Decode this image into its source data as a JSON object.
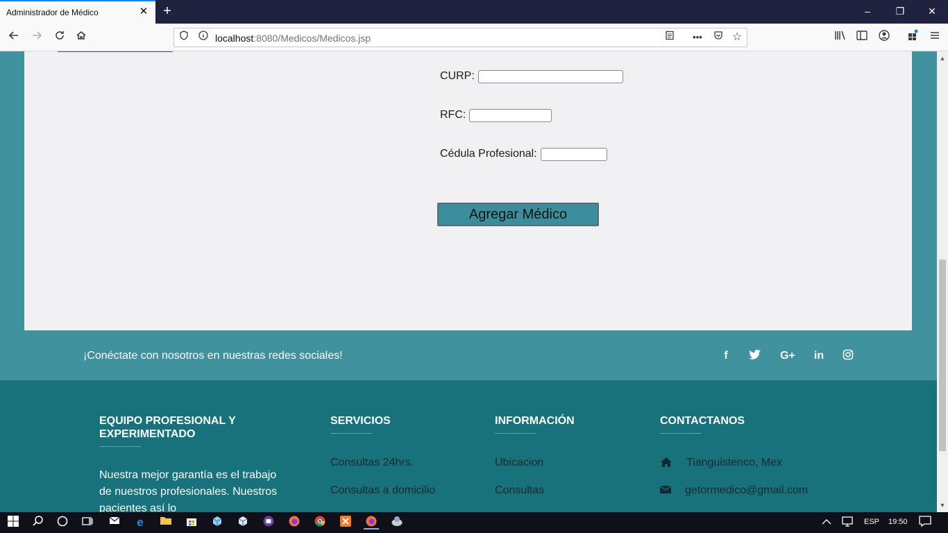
{
  "browser": {
    "tab_title": "Administrador de Médico",
    "tab_close": "✕",
    "new_tab": "+",
    "url_host": "localhost",
    "url_rest": ":8080/Medicos/Medicos.jsp",
    "window_controls": {
      "minimize": "–",
      "restore": "❐",
      "close": "✕"
    },
    "icons": [
      "back-icon",
      "forward-icon",
      "reload-icon",
      "home-icon",
      "shield-icon",
      "info-icon",
      "reader-view-icon",
      "more-icon",
      "pocket-icon",
      "bookmark-star-icon",
      "library-icon",
      "sidebar-icon",
      "account-icon",
      "extensions-icon",
      "menu-icon"
    ]
  },
  "form": {
    "curp_label": "CURP:",
    "curp_value": "",
    "rfc_label": "RFC:",
    "rfc_value": "",
    "cedula_label": "Cédula Profesional:",
    "cedula_value": "",
    "submit_label": "Agregar Médico"
  },
  "social": {
    "text": "¡Conéctate con nosotros en nuestras redes sociales!",
    "icons": [
      {
        "name": "facebook-icon",
        "glyph": "f"
      },
      {
        "name": "twitter-icon",
        "glyph": "🐦"
      },
      {
        "name": "google-plus-icon",
        "glyph": "G+"
      },
      {
        "name": "linkedin-icon",
        "glyph": "in"
      },
      {
        "name": "instagram-icon",
        "glyph": "◎"
      }
    ]
  },
  "footer": {
    "col1": {
      "title": "EQUIPO PROFESIONAL Y EXPERIMENTADO",
      "text": "Nuestra mejor garantía es el trabajo de nuestros profesionales. Nuestros pacientes así lo"
    },
    "col2": {
      "title": "SERVICIOS",
      "links": [
        "Consultas 24hrs.",
        "Consultas a domicilio"
      ]
    },
    "col3": {
      "title": "INFORMACIÓN",
      "links": [
        "Ubicacion",
        "Consultas"
      ]
    },
    "col4": {
      "title": "CONTACTANOS",
      "address": "Tianguistenco, Mex",
      "email": "getormedico@gmail.com"
    }
  },
  "taskbar": {
    "language": "ESP",
    "time": "19:50"
  },
  "colors": {
    "panel": "#f1f1f3",
    "social_bar": "#3f929e",
    "footer": "#17727c",
    "button": "#3b8f9c",
    "tabbar": "#202340"
  }
}
